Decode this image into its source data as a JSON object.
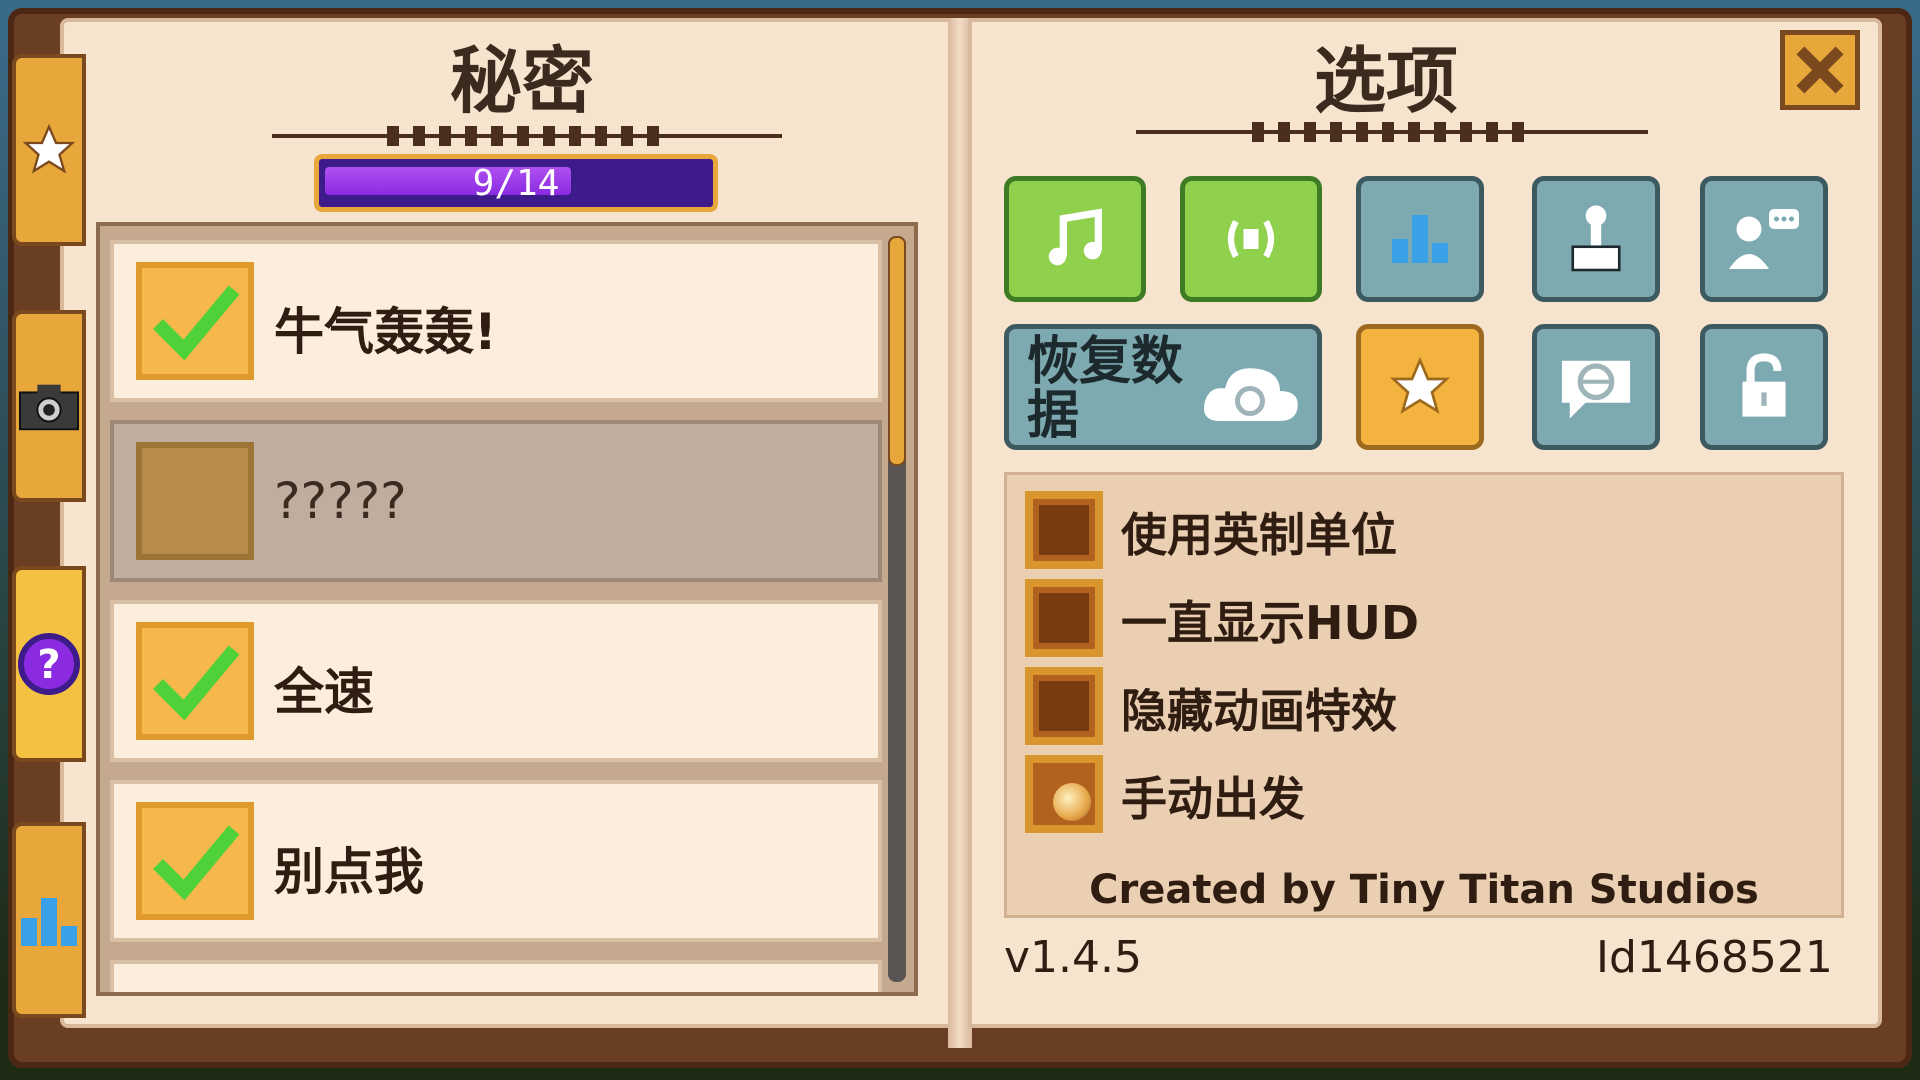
{
  "left_page": {
    "title": "秘密",
    "progress": {
      "text": "9/14",
      "current": 9,
      "total": 14
    },
    "secrets": [
      {
        "label": "牛气轰轰!",
        "completed": true
      },
      {
        "label": "?????",
        "completed": false
      },
      {
        "label": "全速",
        "completed": true
      },
      {
        "label": "别点我",
        "completed": true
      }
    ]
  },
  "side_tabs": [
    {
      "icon": "star-icon",
      "active": false
    },
    {
      "icon": "camera-icon",
      "active": false
    },
    {
      "icon": "question-icon",
      "active": true
    },
    {
      "icon": "bar-chart-icon",
      "active": false
    }
  ],
  "right_page": {
    "title": "选项",
    "buttons": [
      {
        "icon": "music-icon"
      },
      {
        "icon": "sound-icon"
      },
      {
        "icon": "stats-icon"
      },
      {
        "icon": "joystick-icon"
      },
      {
        "icon": "chat-user-icon"
      },
      {
        "label": "恢复数据",
        "icon": "cloud-sync-icon"
      },
      {
        "icon": "star-icon"
      },
      {
        "icon": "language-globe-icon"
      },
      {
        "icon": "lock-icon"
      }
    ],
    "options": [
      {
        "label": "使用英制单位",
        "checked": false
      },
      {
        "label": "一直显示HUD",
        "checked": false
      },
      {
        "label": "隐藏动画特效",
        "checked": false
      },
      {
        "label": "手动出发",
        "checked": true
      }
    ],
    "credit": "Created by Tiny Titan Studios",
    "version": "v1.4.5",
    "user_id": "Id1468521"
  },
  "colors": {
    "page": "#f7e4cf",
    "accent_orange": "#e8a73a",
    "progress_purple": "#3d1b8a",
    "check_green": "#4fd13a",
    "button_teal": "#7da9b0",
    "button_green": "#8fd04c"
  }
}
